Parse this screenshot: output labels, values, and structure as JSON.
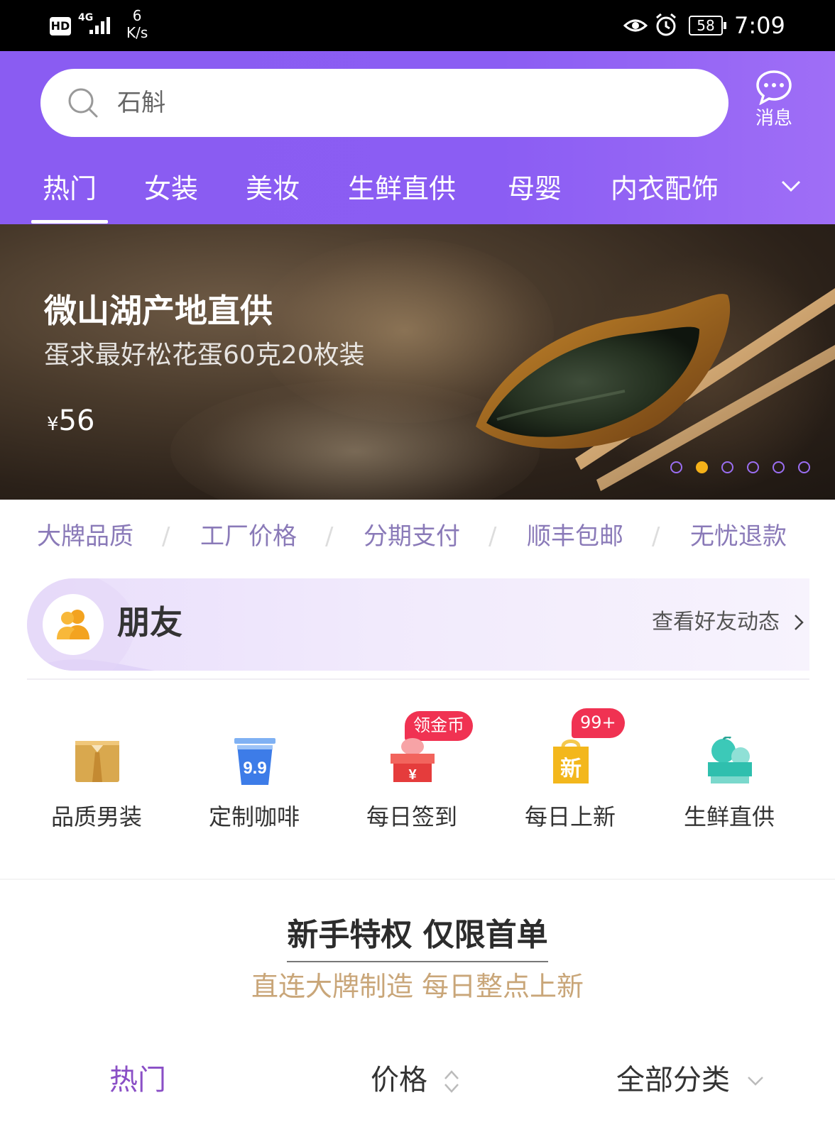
{
  "status_bar": {
    "hd": "HD",
    "network": "4G",
    "speed_value": "6",
    "speed_unit": "K/s",
    "battery": "58",
    "time": "7:09"
  },
  "header": {
    "search_placeholder": "石斛",
    "message_label": "消息",
    "tabs": [
      "热门",
      "女装",
      "美妆",
      "生鲜直供",
      "母婴",
      "内衣配饰"
    ],
    "active_tab": "热门"
  },
  "banner": {
    "title": "微山湖产地直供",
    "subtitle": "蛋求最好松花蛋60克20枚装",
    "price_currency": "¥",
    "price_value": "56",
    "slide_count": 6,
    "active_slide": 1
  },
  "features": [
    "大牌品质",
    "工厂价格",
    "分期支付",
    "顺丰包邮",
    "无忧退款"
  ],
  "friends": {
    "title": "朋友",
    "link": "查看好友动态"
  },
  "quick_links": [
    {
      "label": "品质男装",
      "icon": "menswear-icon"
    },
    {
      "label": "定制咖啡",
      "icon": "coffee-cup-icon",
      "icon_text": "9.9"
    },
    {
      "label": "每日签到",
      "icon": "gift-box-icon",
      "icon_text": "¥",
      "badge": "领金币"
    },
    {
      "label": "每日上新",
      "icon": "new-bag-icon",
      "icon_text": "新",
      "badge": "99+"
    },
    {
      "label": "生鲜直供",
      "icon": "fresh-fruit-icon"
    }
  ],
  "promo": {
    "title": "新手特权 仅限首单",
    "subtitle": "直连大牌制造 每日整点上新"
  },
  "filter_bar": {
    "hot": "热门",
    "price": "价格",
    "category": "全部分类"
  },
  "colors": {
    "brand_purple": "#8b5df3",
    "active_dot": "#f5b119",
    "badge_red": "#f03252",
    "promo_gold": "#c9a679",
    "filter_active": "#8a4fc6"
  }
}
